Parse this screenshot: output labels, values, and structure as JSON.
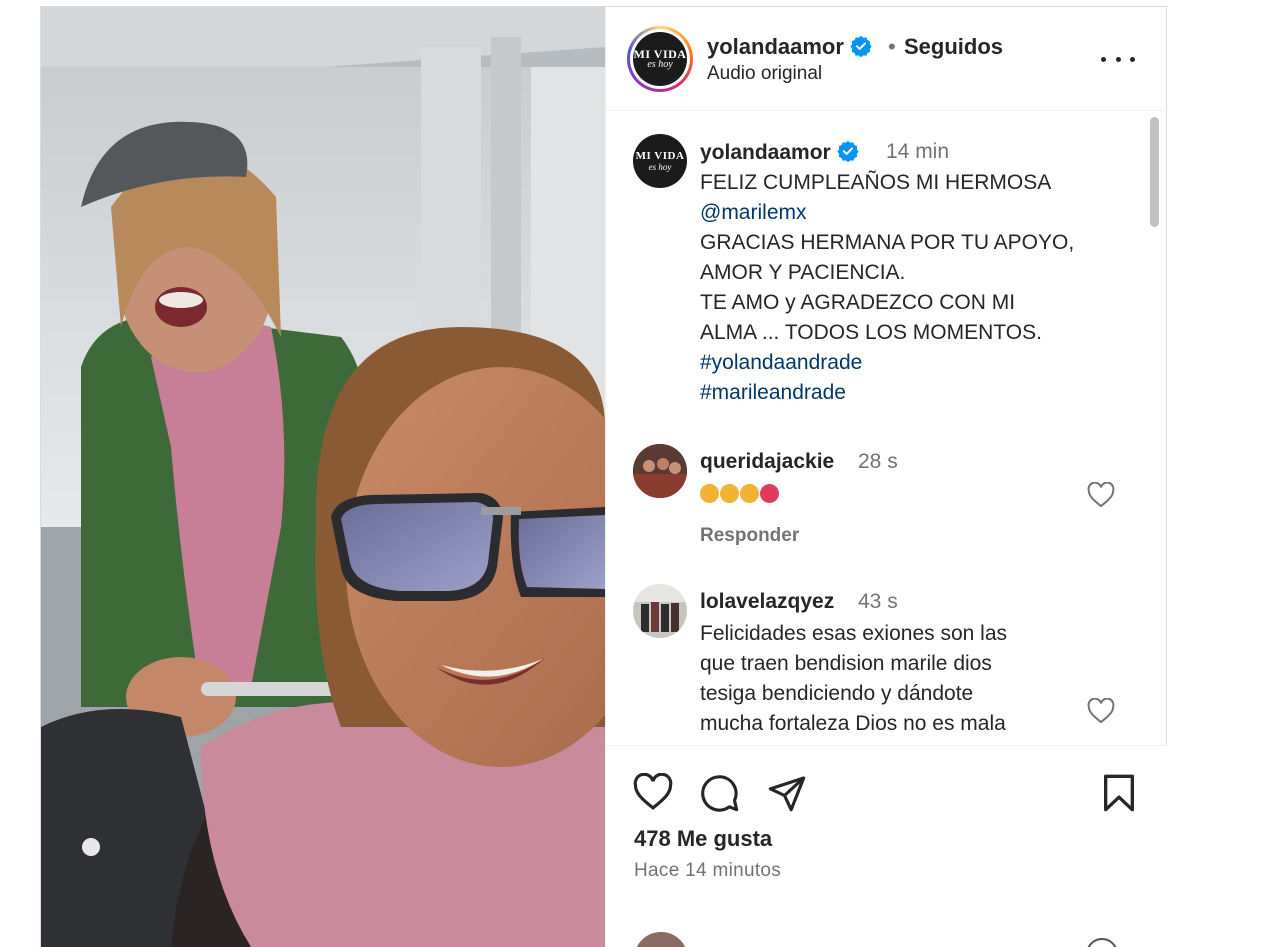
{
  "header": {
    "avatar_logo_line1": "MI VIDA",
    "avatar_logo_line2": "es hoy",
    "username": "yolandaamor",
    "separator": "•",
    "follow_status": "Seguidos",
    "audio": "Audio original",
    "more_icon": "more-horizontal-icon"
  },
  "caption": {
    "username": "yolandaamor",
    "time": "14 min",
    "lines": [
      "FELIZ CUMPLEAÑOS MI HERMOSA",
      "@marilemx",
      "GRACIAS HERMANA POR TU APOYO,",
      "AMOR Y PACIENCIA.",
      "TE AMO y AGRADEZCO CON MI",
      "ALMA ... TODOS LOS MOMENTOS.",
      "#yolandaandrade",
      "#marileandrade"
    ]
  },
  "comments": [
    {
      "username": "queridajackie",
      "time": "28 s",
      "emojis": [
        "partying-face-emoji",
        "partying-face-emoji",
        "partying-face-emoji",
        "hibiscus-emoji"
      ],
      "reply_label": "Responder"
    },
    {
      "username": "lolavelazqyez",
      "time": "43 s",
      "lines": [
        "Felicidades esas exiones son las",
        "que traen bendision marile dios",
        "tesiga bendiciendo y dándote",
        "mucha fortaleza Dios no es mala"
      ]
    }
  ],
  "actions": {
    "likes": "478 Me gusta",
    "time_ago": "Hace 14 minutos",
    "icons": [
      "heart-icon",
      "comment-icon",
      "share-icon",
      "bookmark-icon"
    ]
  },
  "colors": {
    "link": "#00376b",
    "verified": "#0095f6",
    "muted": "#737373",
    "text": "#262626"
  }
}
